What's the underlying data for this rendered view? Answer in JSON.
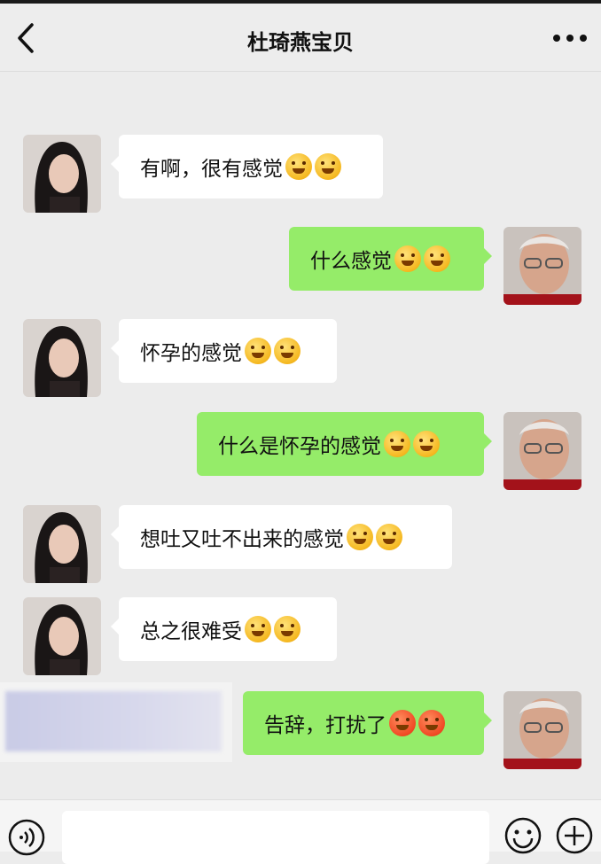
{
  "header": {
    "title": "杜琦燕宝贝"
  },
  "messages": [
    {
      "side": "in",
      "text": "有啊，很有感觉",
      "emoji": [
        "grin",
        "grin"
      ]
    },
    {
      "side": "out",
      "text": "什么感觉",
      "emoji": [
        "dizzy",
        "dizzy"
      ]
    },
    {
      "side": "in",
      "text": "怀孕的感觉",
      "emoji": [
        "wink-tongue",
        "wink-tongue"
      ]
    },
    {
      "side": "out",
      "text": "什么是怀孕的感觉",
      "emoji": [
        "wink-tongue",
        "wink-tongue"
      ]
    },
    {
      "side": "in",
      "text": "想吐又吐不出来的感觉",
      "emoji": [
        "tears-of-joy",
        "tears-of-joy"
      ]
    },
    {
      "side": "in",
      "text": "总之很难受",
      "emoji": [
        "grin",
        "grin"
      ]
    },
    {
      "side": "out",
      "text": "告辞，打扰了",
      "emoji": [
        "sweat-red",
        "sweat-red"
      ]
    }
  ],
  "icons": {
    "back": "chevron-left-icon",
    "more": "more-dots-icon",
    "voice": "voice-icon",
    "emoji": "smiley-icon",
    "plus": "plus-icon"
  },
  "colors": {
    "outgoing_bubble": "#95ec69",
    "incoming_bubble": "#ffffff",
    "background": "#ececec"
  }
}
